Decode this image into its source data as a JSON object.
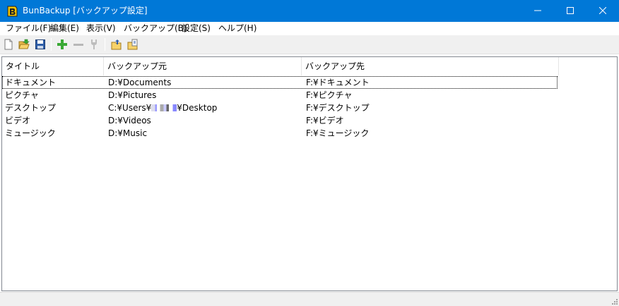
{
  "window": {
    "title": "BunBackup [バックアップ設定]",
    "app_icon": "bunbackup-app-icon",
    "controls": [
      "minimize-icon",
      "maximize-icon",
      "close-icon"
    ],
    "titlebar_color": "#0078d7"
  },
  "menu": [
    {
      "label": "ファイル(F)"
    },
    {
      "label": "編集(E)"
    },
    {
      "label": "表示(V)"
    },
    {
      "label": "バックアップ(B)"
    },
    {
      "label": "設定(S)"
    },
    {
      "label": "ヘルプ(H)"
    }
  ],
  "toolbar": {
    "icons": [
      "new-file-icon",
      "open-folder-icon",
      "save-icon",
      "add-icon",
      "remove-icon",
      "properties-icon",
      "backup-icon",
      "restore-icon"
    ]
  },
  "list": {
    "columns": [
      "タイトル",
      "バックアップ元",
      "バックアップ先"
    ],
    "rows": [
      {
        "title": "ドキュメント",
        "source": "D:¥Documents",
        "dest": "F:¥ドキュメント",
        "selected": true
      },
      {
        "title": "ピクチャ",
        "source": "D:¥Pictures",
        "dest": "F:¥ピクチャ"
      },
      {
        "title": "デスクトップ",
        "source_prefix": "C:¥Users¥",
        "source_suffix": "¥Desktop",
        "source_masked": true,
        "dest": "F:¥デスクトップ"
      },
      {
        "title": "ビデオ",
        "source": "D:¥Videos",
        "dest": "F:¥ビデオ"
      },
      {
        "title": "ミュージック",
        "source": "D:¥Music",
        "dest": "F:¥ミュージック"
      }
    ]
  }
}
